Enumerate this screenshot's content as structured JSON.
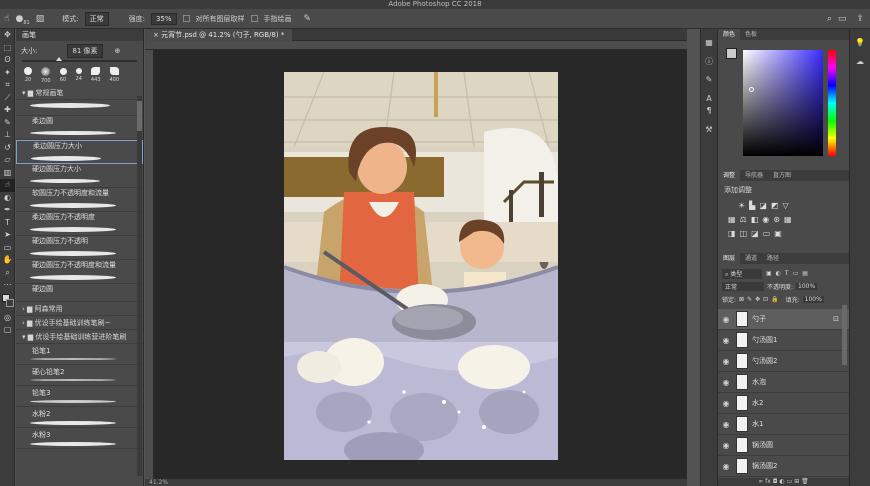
{
  "app": {
    "title": "Adobe Photoshop CC 2018"
  },
  "options_bar": {
    "mode_label": "模式:",
    "mode_value": "正常",
    "strength_label": "强度:",
    "strength_value": "35%",
    "sample_all_label": "对所有图层取样",
    "finger_paint_label": "手指绘画",
    "brush_size_badge": "81"
  },
  "brush_panel": {
    "title": "画笔",
    "size_label": "大小:",
    "size_value": "81 像素",
    "preset_sizes": [
      "20",
      "700",
      "60",
      "24",
      "443",
      "400"
    ],
    "folder_general": "常规画笔",
    "brushes": [
      "柔边圆",
      "柔边圆压力大小",
      "硬边圆压力大小",
      "软圆压力不透明度和流量",
      "柔边圆压力不透明度",
      "硬边圆压力不透明",
      "硬边圆压力不透明度和流量",
      "硬边圆"
    ],
    "folders": [
      "阿森常用",
      "优设手绘基础训练笔刷~",
      "优设手绘基础训练营进阶笔刷"
    ],
    "sub_brushes": [
      "铅笔1",
      "硬心铅笔2",
      "铅笔3",
      "水粉2",
      "水粉3"
    ]
  },
  "document": {
    "tab_title": "元宵节.psd @ 41.2% (勺子, RGB/8) *",
    "status": "41.2%"
  },
  "color_panel": {
    "tabs": [
      "颜色",
      "色板"
    ]
  },
  "adjust_panel": {
    "tabs": [
      "调整",
      "导航器",
      "直方图"
    ],
    "add_label": "添加调整"
  },
  "layers_panel": {
    "tabs": [
      "图层",
      "通道",
      "路径"
    ],
    "filter_label": "类型",
    "blend_mode": "正常",
    "opacity_label": "不透明度:",
    "opacity_value": "100%",
    "lock_label": "锁定:",
    "fill_label": "填充:",
    "fill_value": "100%",
    "layers": [
      "勺子",
      "勺汤圆1",
      "勺汤圆2",
      "水泡",
      "水2",
      "水1",
      "锅汤圆",
      "锅汤圆2"
    ]
  },
  "colors": {
    "accent": "#e65f39"
  }
}
